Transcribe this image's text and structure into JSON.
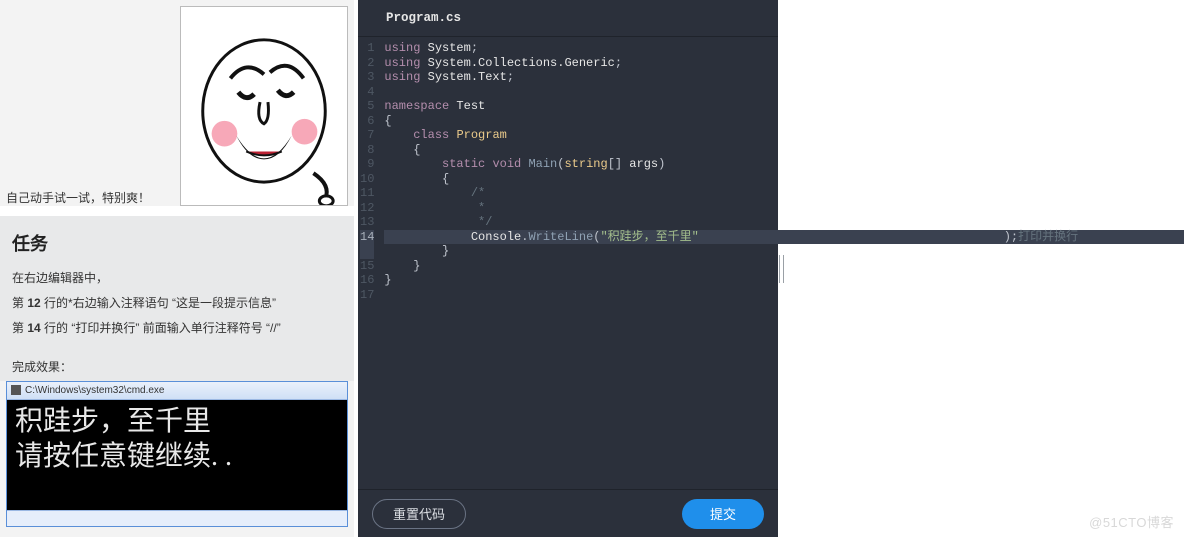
{
  "left": {
    "meme_caption": "自己动手试一试，特别爽！",
    "task_title": "任务",
    "task_intro": "在右边编辑器中，",
    "task_line1_prefix": "第 ",
    "task_line1_num": "12",
    "task_line1_rest": " 行的*右边输入注释语句 “这是一段提示信息”",
    "task_line2_prefix": "第 ",
    "task_line2_num": "14",
    "task_line2_rest": " 行的 “打印并换行” 前面输入单行注释符号 “//”",
    "result_label": "完成效果：",
    "cmd_title": "C:\\Windows\\system32\\cmd.exe",
    "cmd_line1": "积跬步，至千里",
    "cmd_line2": "请按任意键继续. ."
  },
  "editor": {
    "tab_label": "Program.cs",
    "reset_label": "重置代码",
    "submit_label": "提交",
    "highlight_line": 14,
    "lines": [
      {
        "n": 1,
        "t": [
          [
            "kw",
            "using"
          ],
          [
            "pn",
            " "
          ],
          [
            "id",
            "System"
          ],
          [
            "pn",
            ";"
          ]
        ]
      },
      {
        "n": 2,
        "t": [
          [
            "kw",
            "using"
          ],
          [
            "pn",
            " "
          ],
          [
            "id",
            "System.Collections.Generic"
          ],
          [
            "pn",
            ";"
          ]
        ]
      },
      {
        "n": 3,
        "t": [
          [
            "kw",
            "using"
          ],
          [
            "pn",
            " "
          ],
          [
            "id",
            "System.Text"
          ],
          [
            "pn",
            ";"
          ]
        ]
      },
      {
        "n": 4,
        "t": []
      },
      {
        "n": 5,
        "t": [
          [
            "kw",
            "namespace"
          ],
          [
            "pn",
            " "
          ],
          [
            "id",
            "Test"
          ]
        ]
      },
      {
        "n": 6,
        "t": [
          [
            "pn",
            "{"
          ]
        ]
      },
      {
        "n": 7,
        "t": [
          [
            "pn",
            "    "
          ],
          [
            "kw",
            "class"
          ],
          [
            "pn",
            " "
          ],
          [
            "ty",
            "Program"
          ]
        ]
      },
      {
        "n": 8,
        "t": [
          [
            "pn",
            "    {"
          ]
        ]
      },
      {
        "n": 9,
        "t": [
          [
            "pn",
            "        "
          ],
          [
            "kw",
            "static"
          ],
          [
            "pn",
            " "
          ],
          [
            "kw",
            "void"
          ],
          [
            "pn",
            " "
          ],
          [
            "fn",
            "Main"
          ],
          [
            "pn",
            "("
          ],
          [
            "ty",
            "string"
          ],
          [
            "pn",
            "[] "
          ],
          [
            "id",
            "args"
          ],
          [
            "pn",
            ")"
          ]
        ]
      },
      {
        "n": 10,
        "t": [
          [
            "pn",
            "        {"
          ]
        ]
      },
      {
        "n": 11,
        "t": [
          [
            "pn",
            "            "
          ],
          [
            "cm",
            "/*"
          ]
        ]
      },
      {
        "n": 12,
        "t": [
          [
            "pn",
            "             "
          ],
          [
            "cm",
            "*"
          ]
        ]
      },
      {
        "n": 13,
        "t": [
          [
            "pn",
            "             "
          ],
          [
            "cm",
            "*/"
          ]
        ]
      },
      {
        "n": 14,
        "t": [
          [
            "pn",
            "            "
          ],
          [
            "id",
            "Console"
          ],
          [
            "pn",
            "."
          ],
          [
            "fn",
            "WriteLine"
          ],
          [
            "pn",
            "("
          ],
          [
            "str",
            "\"积跬步，至千里\""
          ]
        ]
      },
      {
        "n": "14b",
        "t": [
          [
            "pn",
            "                );"
          ],
          [
            "cm",
            "打印并换行"
          ]
        ]
      },
      {
        "n": 15,
        "t": [
          [
            "pn",
            "        }"
          ]
        ]
      },
      {
        "n": 16,
        "t": [
          [
            "pn",
            "    }"
          ]
        ]
      },
      {
        "n": 17,
        "t": [
          [
            "pn",
            "}"
          ]
        ]
      }
    ]
  },
  "watermark": "@51CTO博客"
}
